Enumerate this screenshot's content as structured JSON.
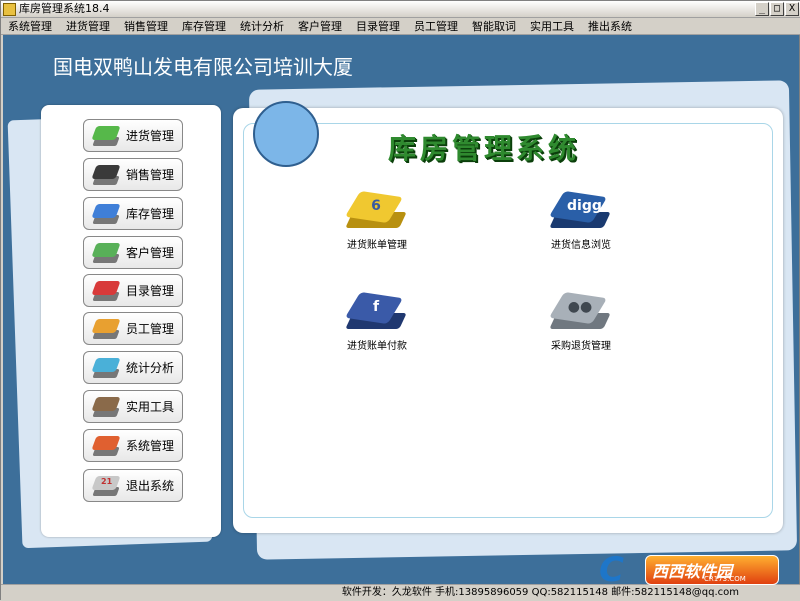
{
  "window": {
    "title": "库房管理系统18.4",
    "min_label": "_",
    "max_label": "□",
    "close_label": "X"
  },
  "menu": [
    "系统管理",
    "进货管理",
    "销售管理",
    "库存管理",
    "统计分析",
    "客户管理",
    "目录管理",
    "员工管理",
    "智能取词",
    "实用工具",
    "推出系统"
  ],
  "company_name": "国电双鸭山发电有限公司培训大厦",
  "system_title": "库房管理系统",
  "sidebar": [
    {
      "label": "进货管理",
      "color": "#56b84a",
      "icon": "add-icon"
    },
    {
      "label": "销售管理",
      "color": "#3a3a3a",
      "icon": "sales-icon"
    },
    {
      "label": "库存管理",
      "color": "#3f7fd8",
      "icon": "inventory-icon"
    },
    {
      "label": "客户管理",
      "color": "#58b058",
      "icon": "customer-icon"
    },
    {
      "label": "目录管理",
      "color": "#d83a3a",
      "icon": "catalog-icon"
    },
    {
      "label": "员工管理",
      "color": "#e8a030",
      "icon": "employee-icon"
    },
    {
      "label": "统计分析",
      "color": "#4ab0d8",
      "icon": "stats-icon"
    },
    {
      "label": "实用工具",
      "color": "#8a6a4a",
      "icon": "tools-icon"
    },
    {
      "label": "系统管理",
      "color": "#e06030",
      "icon": "system-icon"
    },
    {
      "label": "退出系统",
      "color": "#c8c8c8",
      "icon": "calendar-icon",
      "glyph": "21"
    }
  ],
  "tiles": [
    {
      "label": "进货账单管理",
      "color": "#f0c830",
      "base": "#b89010",
      "glyph": "6",
      "glyph_color": "#3a5aa0",
      "icon": "purchase-bill-icon"
    },
    {
      "label": "进货信息浏览",
      "color": "#2a5fa8",
      "base": "#1a3a70",
      "glyph": "digg",
      "glyph_color": "#ffffff",
      "icon": "purchase-info-icon"
    },
    {
      "label": "进货账单付款",
      "color": "#3a5aa8",
      "base": "#203870",
      "glyph": "f",
      "glyph_color": "#ffffff",
      "icon": "payment-icon"
    },
    {
      "label": "采购退货管理",
      "color": "#a8b0b8",
      "base": "#707880",
      "glyph": "●●",
      "glyph_color": "#404850",
      "icon": "return-icon"
    }
  ],
  "status": "软件开发：久龙软件   手机:13895896059   QQ:582115148   邮件:582115148@qq.com",
  "watermark": {
    "letter": "C",
    "main": "西西软件园",
    "sub": "CR173.COM"
  }
}
